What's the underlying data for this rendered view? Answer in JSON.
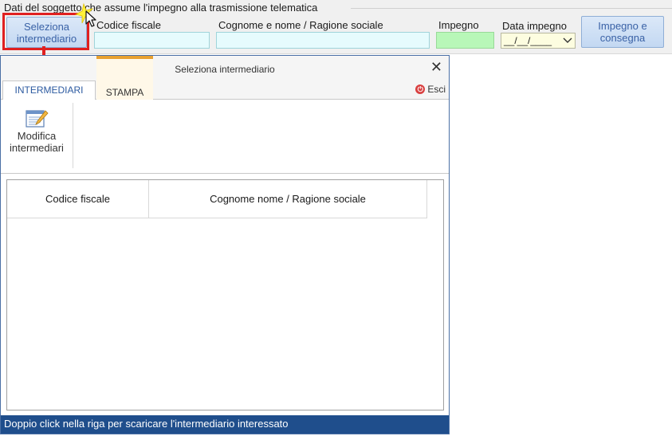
{
  "form": {
    "legend": "Dati del soggetto che assume l'impegno alla trasmissione telematica",
    "select_button": [
      "Seleziona",
      "intermediario"
    ],
    "fields": {
      "codice_fiscale_label": "Codice fiscale",
      "cognome_label": "Cognome e nome / Ragione sociale",
      "impegno_label": "Impegno",
      "data_label": "Data impegno",
      "data_value": "__/__/____"
    },
    "commit_button": [
      "Impegno e",
      "consegna"
    ]
  },
  "dialog": {
    "title": "Seleziona intermediario",
    "close_symbol": "✕",
    "tabs": [
      {
        "label": "INTERMEDIARI",
        "active": true
      },
      {
        "label": "STAMPA",
        "active": false
      }
    ],
    "exit_label": "Esci",
    "ribbon": {
      "edit_button": [
        "Modifica",
        "intermediari"
      ],
      "edit_icon": "edit-list-icon"
    },
    "grid": {
      "columns": [
        "Codice fiscale",
        "Cognome nome / Ragione sociale"
      ],
      "rows": []
    },
    "status": "Doppio click nella riga per scaricare l'intermediario interessato"
  },
  "colors": {
    "accent_blue": "#1f4e8c",
    "highlight_red": "#e02020",
    "cf_field": "#e6fbfd",
    "impegno_field": "#b8f7b8",
    "date_field": "#fdfde0",
    "print_tab": "#e8a030"
  }
}
